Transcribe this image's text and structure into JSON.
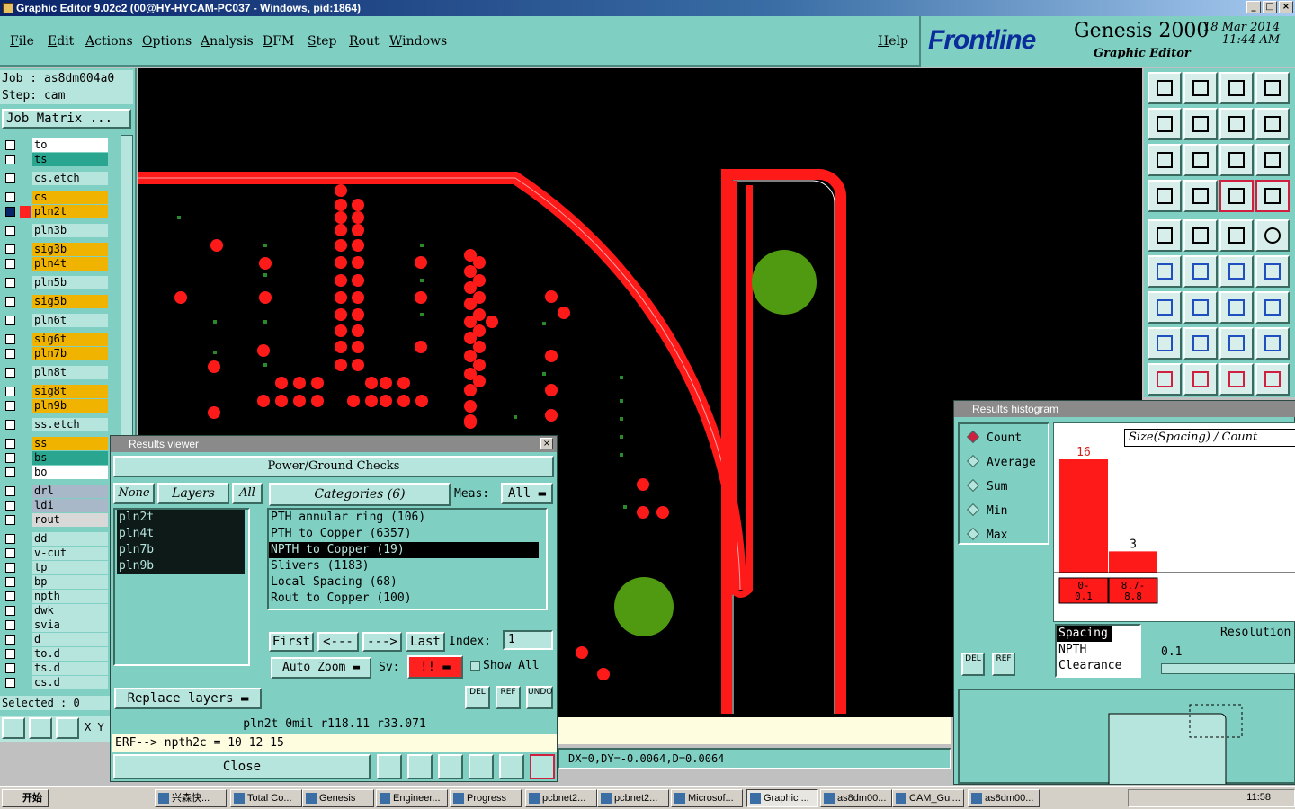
{
  "window": {
    "title": "Graphic Editor 9.02c2 (00@HY-HYCAM-PC037 - Windows, pid:1864)"
  },
  "menu": [
    "File",
    "Edit",
    "Actions",
    "Options",
    "Analysis",
    "DFM",
    "Step",
    "Rout",
    "Windows"
  ],
  "help_label": "Help",
  "brand": {
    "logo": "Frontline",
    "product": "Genesis 2000",
    "subtitle": "Graphic Editor",
    "date": "18 Mar 2014",
    "time": "11:44 AM"
  },
  "job": {
    "job_line": "Job : as8dm004a0",
    "step_line": "Step: cam",
    "matrix_label": "Job Matrix ..."
  },
  "layers": [
    {
      "name": "to",
      "color": "#ffffff",
      "swatch": ""
    },
    {
      "name": "ts",
      "color": "#2aa58f",
      "swatch": ""
    },
    {
      "name": "cs.etch",
      "color": "#b6e5dd",
      "swatch": ""
    },
    {
      "name": "cs",
      "color": "#f0b400",
      "swatch": ""
    },
    {
      "name": "pln2t",
      "color": "#f0b400",
      "swatch": "#ff2020"
    },
    {
      "name": "pln3b",
      "color": "#b6e5dd",
      "swatch": ""
    },
    {
      "name": "sig3b",
      "color": "#f0b400",
      "swatch": ""
    },
    {
      "name": "pln4t",
      "color": "#f0b400",
      "swatch": ""
    },
    {
      "name": "pln5b",
      "color": "#b6e5dd",
      "swatch": ""
    },
    {
      "name": "sig5b",
      "color": "#f0b400",
      "swatch": ""
    },
    {
      "name": "pln6t",
      "color": "#b6e5dd",
      "swatch": ""
    },
    {
      "name": "sig6t",
      "color": "#f0b400",
      "swatch": ""
    },
    {
      "name": "pln7b",
      "color": "#f0b400",
      "swatch": ""
    },
    {
      "name": "pln8t",
      "color": "#b6e5dd",
      "swatch": ""
    },
    {
      "name": "sig8t",
      "color": "#f0b400",
      "swatch": ""
    },
    {
      "name": "pln9b",
      "color": "#f0b400",
      "swatch": ""
    },
    {
      "name": "ss.etch",
      "color": "#b6e5dd",
      "swatch": ""
    },
    {
      "name": "ss",
      "color": "#f0b400",
      "swatch": ""
    },
    {
      "name": "bs",
      "color": "#2aa58f",
      "swatch": ""
    },
    {
      "name": "bo",
      "color": "#ffffff",
      "swatch": ""
    },
    {
      "name": "drl",
      "color": "#a8b8c8",
      "swatch": ""
    },
    {
      "name": "ldi",
      "color": "#a8b8c8",
      "swatch": ""
    },
    {
      "name": "rout",
      "color": "#d8d8d8",
      "swatch": ""
    },
    {
      "name": "dd",
      "color": "#b6e5dd",
      "swatch": ""
    },
    {
      "name": "v-cut",
      "color": "#b6e5dd",
      "swatch": ""
    },
    {
      "name": "tp",
      "color": "#b6e5dd",
      "swatch": ""
    },
    {
      "name": "bp",
      "color": "#b6e5dd",
      "swatch": ""
    },
    {
      "name": "npth",
      "color": "#b6e5dd",
      "swatch": ""
    },
    {
      "name": "dwk",
      "color": "#b6e5dd",
      "swatch": ""
    },
    {
      "name": "svia",
      "color": "#b6e5dd",
      "swatch": ""
    },
    {
      "name": "d",
      "color": "#b6e5dd",
      "swatch": ""
    },
    {
      "name": "to.d",
      "color": "#b6e5dd",
      "swatch": ""
    },
    {
      "name": "ts.d",
      "color": "#b6e5dd",
      "swatch": ""
    },
    {
      "name": "cs.d",
      "color": "#b6e5dd",
      "swatch": ""
    }
  ],
  "selected_label": "Selected : 0",
  "xy_label": "X Y",
  "results_viewer": {
    "title": "Results viewer",
    "heading": "Power/Ground Checks",
    "none_btn": "None",
    "layers_btn": "Layers",
    "all_btn": "All",
    "layer_items": [
      "pln2t",
      "pln4t",
      "pln7b",
      "pln9b"
    ],
    "categories_label": "Categories (6)",
    "meas_label": "Meas:",
    "meas_value": "All",
    "categories": [
      "PTH annular ring (106)",
      "PTH to Copper (6357)",
      "NPTH to Copper (19)",
      "Slivers (1183)",
      "Local Spacing (68)",
      "Rout to Copper (100)"
    ],
    "first_btn": "First",
    "prev_btn": "<---",
    "next_btn": "--->",
    "last_btn": "Last",
    "index_label": "Index:",
    "index_value": "1",
    "zoom_value": "Auto Zoom",
    "sv_label": "Sv:",
    "sv_value": "!!",
    "show_all": "Show All",
    "replace_layers": "Replace layers",
    "del_label": "DEL",
    "ref_label": "REF",
    "undo_label": "UNDO",
    "status": "pln2t  0mil   r118.11   r33.071",
    "erf": "ERF--> npth2c = 10 12 15",
    "close_btn": "Close"
  },
  "dx_status": "DX=0,DY=-0.0064,D=0.0064",
  "histogram": {
    "title": "Results histogram",
    "modes": [
      "Count",
      "Average",
      "Sum",
      "Min",
      "Max"
    ],
    "selected_mode": "Count",
    "axis_title": "Size(Spacing) / Count",
    "bars": [
      {
        "label": "0-\n0.1",
        "count": 16
      },
      {
        "label": "8.7-\n8.8",
        "count": 3
      }
    ],
    "spacing_items": [
      "Spacing",
      "NPTH",
      "Clearance"
    ],
    "resolution_label": "Resolution",
    "resolution_value": "0.1",
    "del_label": "DEL",
    "ref_label": "REF"
  },
  "taskbar": {
    "start": "开始",
    "tasks": [
      "兴森快...",
      "Total Co...",
      "Genesis",
      "Engineer...",
      "Progress",
      "pcbnet2...",
      "pcbnet2...",
      "Microsof...",
      "Graphic ...",
      "as8dm00...",
      "CAM_Gui...",
      "as8dm00..."
    ],
    "active_task": "Graphic ...",
    "clock": "11:58"
  },
  "colors": {
    "panel": "#7fcfc2",
    "copper": "#ff1a1a",
    "npth_pad": "#4f9a10",
    "via_dot": "#2a8a2a"
  }
}
